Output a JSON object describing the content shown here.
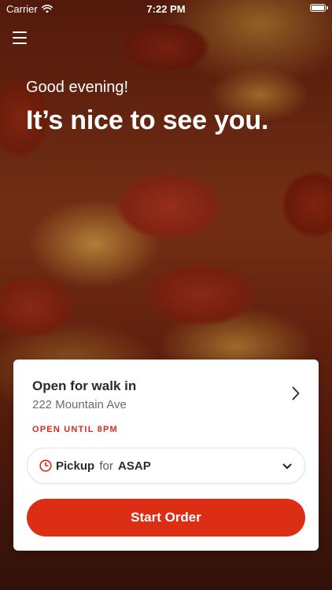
{
  "status_bar": {
    "carrier": "Carrier",
    "time": "7:22 PM",
    "wifi_icon": "wifi-icon",
    "battery_icon": "battery-icon"
  },
  "header": {
    "menu_icon": "hamburger-menu-icon",
    "greeting": "Good evening!",
    "headline": "It’s nice to see you."
  },
  "store_card": {
    "store_name": "Open for walk in",
    "address": "222 Mountain Ave",
    "status": "OPEN UNTIL 8PM",
    "status_color": "#d9291c",
    "chevron_icon": "chevron-right-icon"
  },
  "pickup": {
    "icon": "clock-icon",
    "mode": "Pickup",
    "connector": "for",
    "when": "ASAP",
    "dropdown_icon": "chevron-down-icon"
  },
  "actions": {
    "start_order_label": "Start Order",
    "accent_color": "#dc2d15"
  }
}
